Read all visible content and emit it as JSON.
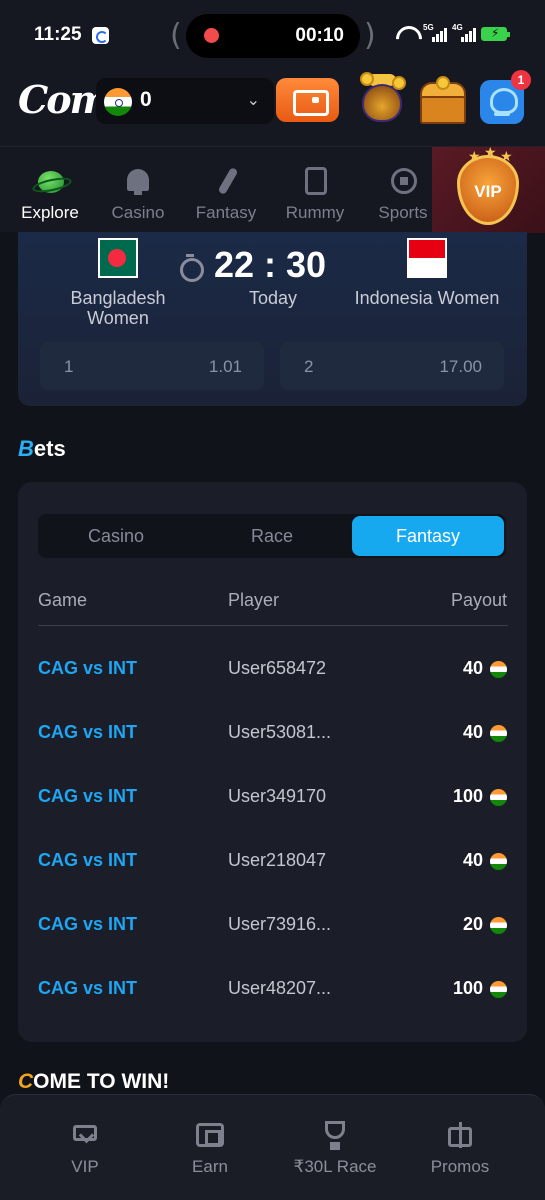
{
  "status_bar": {
    "time": "11:25",
    "recording_time": "00:10",
    "sig1_label": "5G",
    "sig2_label": "4G"
  },
  "header": {
    "logo": "Come",
    "balance": "0",
    "notification_count": "1",
    "icons": [
      "flag-india-icon",
      "chevron-down-icon",
      "wallet-icon",
      "treasure-pot-icon",
      "treasure-chest-icon",
      "support-agent-icon"
    ]
  },
  "categories": [
    {
      "label": "Explore",
      "icon": "planet-icon",
      "active": true
    },
    {
      "label": "Casino",
      "icon": "spade-icon",
      "active": false
    },
    {
      "label": "Fantasy",
      "icon": "cricket-bat-icon",
      "active": false
    },
    {
      "label": "Rummy",
      "icon": "cards-icon",
      "active": false
    },
    {
      "label": "Sports",
      "icon": "football-icon",
      "active": false
    }
  ],
  "vip": {
    "label": "VIP"
  },
  "match": {
    "home_team": "Bangladesh Women",
    "away_team": "Indonesia Women",
    "time": "22 : 30",
    "day": "Today",
    "odds": [
      {
        "label": "1",
        "value": "1.01"
      },
      {
        "label": "2",
        "value": "17.00"
      }
    ]
  },
  "bets": {
    "title_first": "B",
    "title_rest": "ets",
    "tabs": [
      {
        "label": "Casino",
        "active": false
      },
      {
        "label": "Race",
        "active": false
      },
      {
        "label": "Fantasy",
        "active": true
      }
    ],
    "columns": {
      "game": "Game",
      "player": "Player",
      "payout": "Payout"
    },
    "rows": [
      {
        "game": "CAG vs INT",
        "player": "User658472",
        "payout": "40"
      },
      {
        "game": "CAG vs INT",
        "player": "User53081...",
        "payout": "40"
      },
      {
        "game": "CAG vs INT",
        "player": "User349170",
        "payout": "100"
      },
      {
        "game": "CAG vs INT",
        "player": "User218047",
        "payout": "40"
      },
      {
        "game": "CAG vs INT",
        "player": "User73916...",
        "payout": "20"
      },
      {
        "game": "CAG vs INT",
        "player": "User48207...",
        "payout": "100"
      }
    ]
  },
  "promo": {
    "title_first": "C",
    "title_rest": "OME TO WIN!"
  },
  "bottom_nav": [
    {
      "label": "VIP",
      "icon": "diamond-icon"
    },
    {
      "label": "Earn",
      "icon": "earn-icon"
    },
    {
      "label": "₹30L Race",
      "icon": "trophy-icon"
    },
    {
      "label": "Promos",
      "icon": "gift-icon"
    }
  ],
  "colors": {
    "accent": "#16a9f0",
    "link": "#1ea6f2",
    "background": "#11131a",
    "promo_accent": "#f2a51e"
  }
}
